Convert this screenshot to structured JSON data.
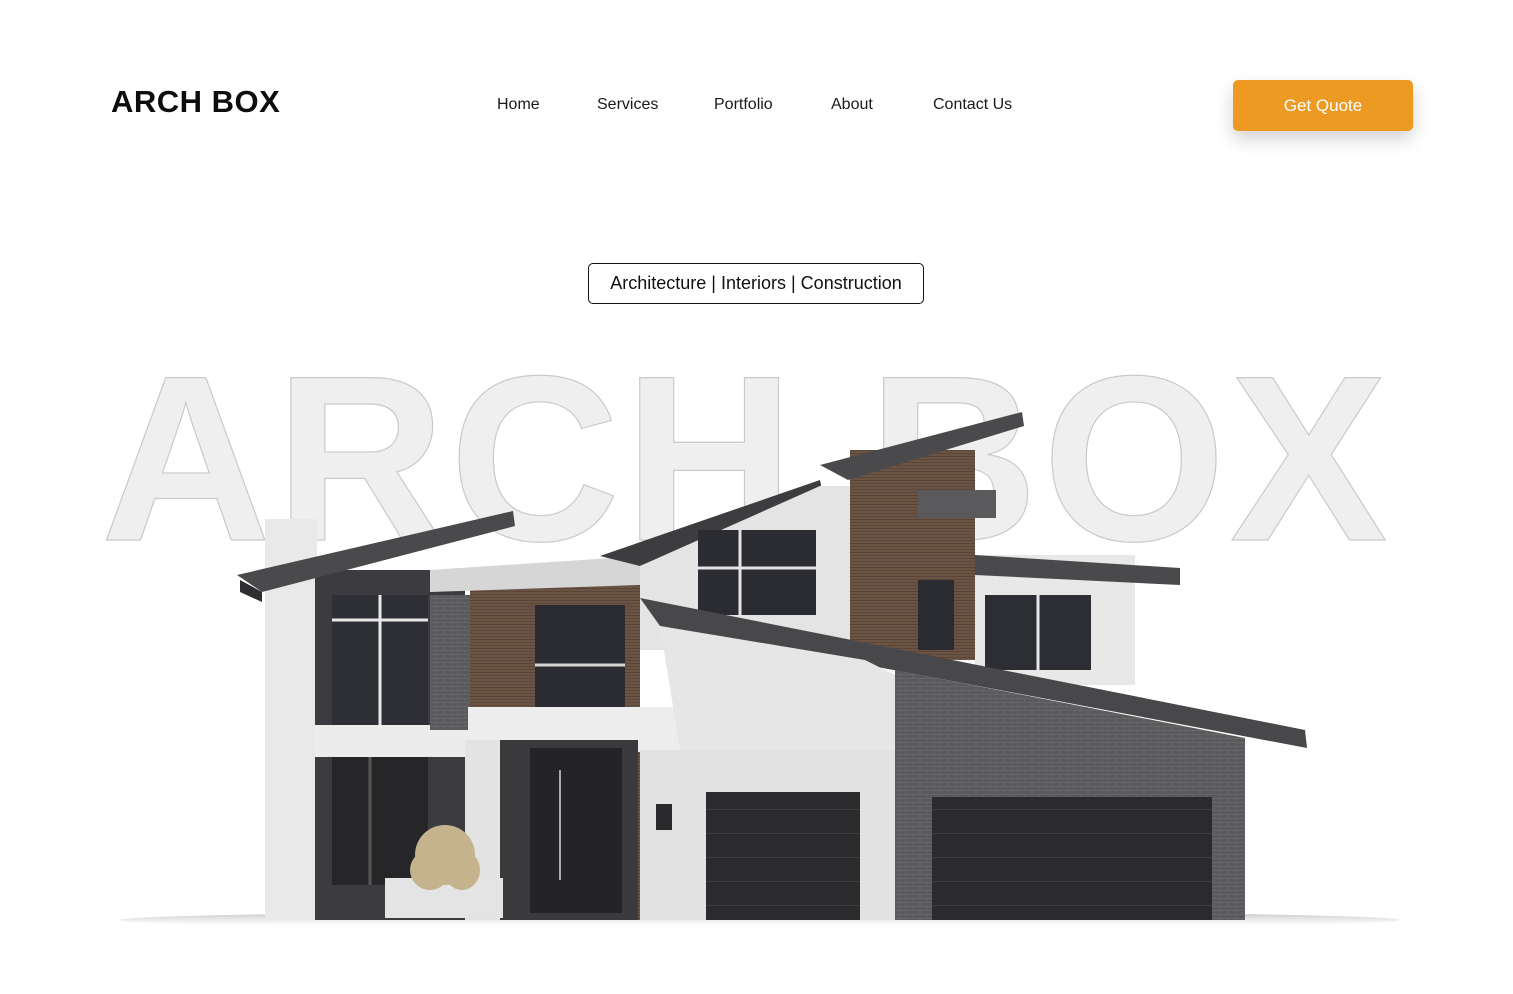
{
  "header": {
    "logo": "ARCH BOX",
    "nav": [
      "Home",
      "Services",
      "Portfolio",
      "About",
      "Contact Us"
    ],
    "cta_label": "Get Quote"
  },
  "hero": {
    "tagline": "Architecture | Interiors | Construction",
    "watermark": "ARCH BOX",
    "image": "modern-house-illustration"
  },
  "colors": {
    "accent": "#ed9a23",
    "text": "#111111",
    "watermark_fill": "#efefef",
    "watermark_stroke": "#c9c9c9"
  }
}
